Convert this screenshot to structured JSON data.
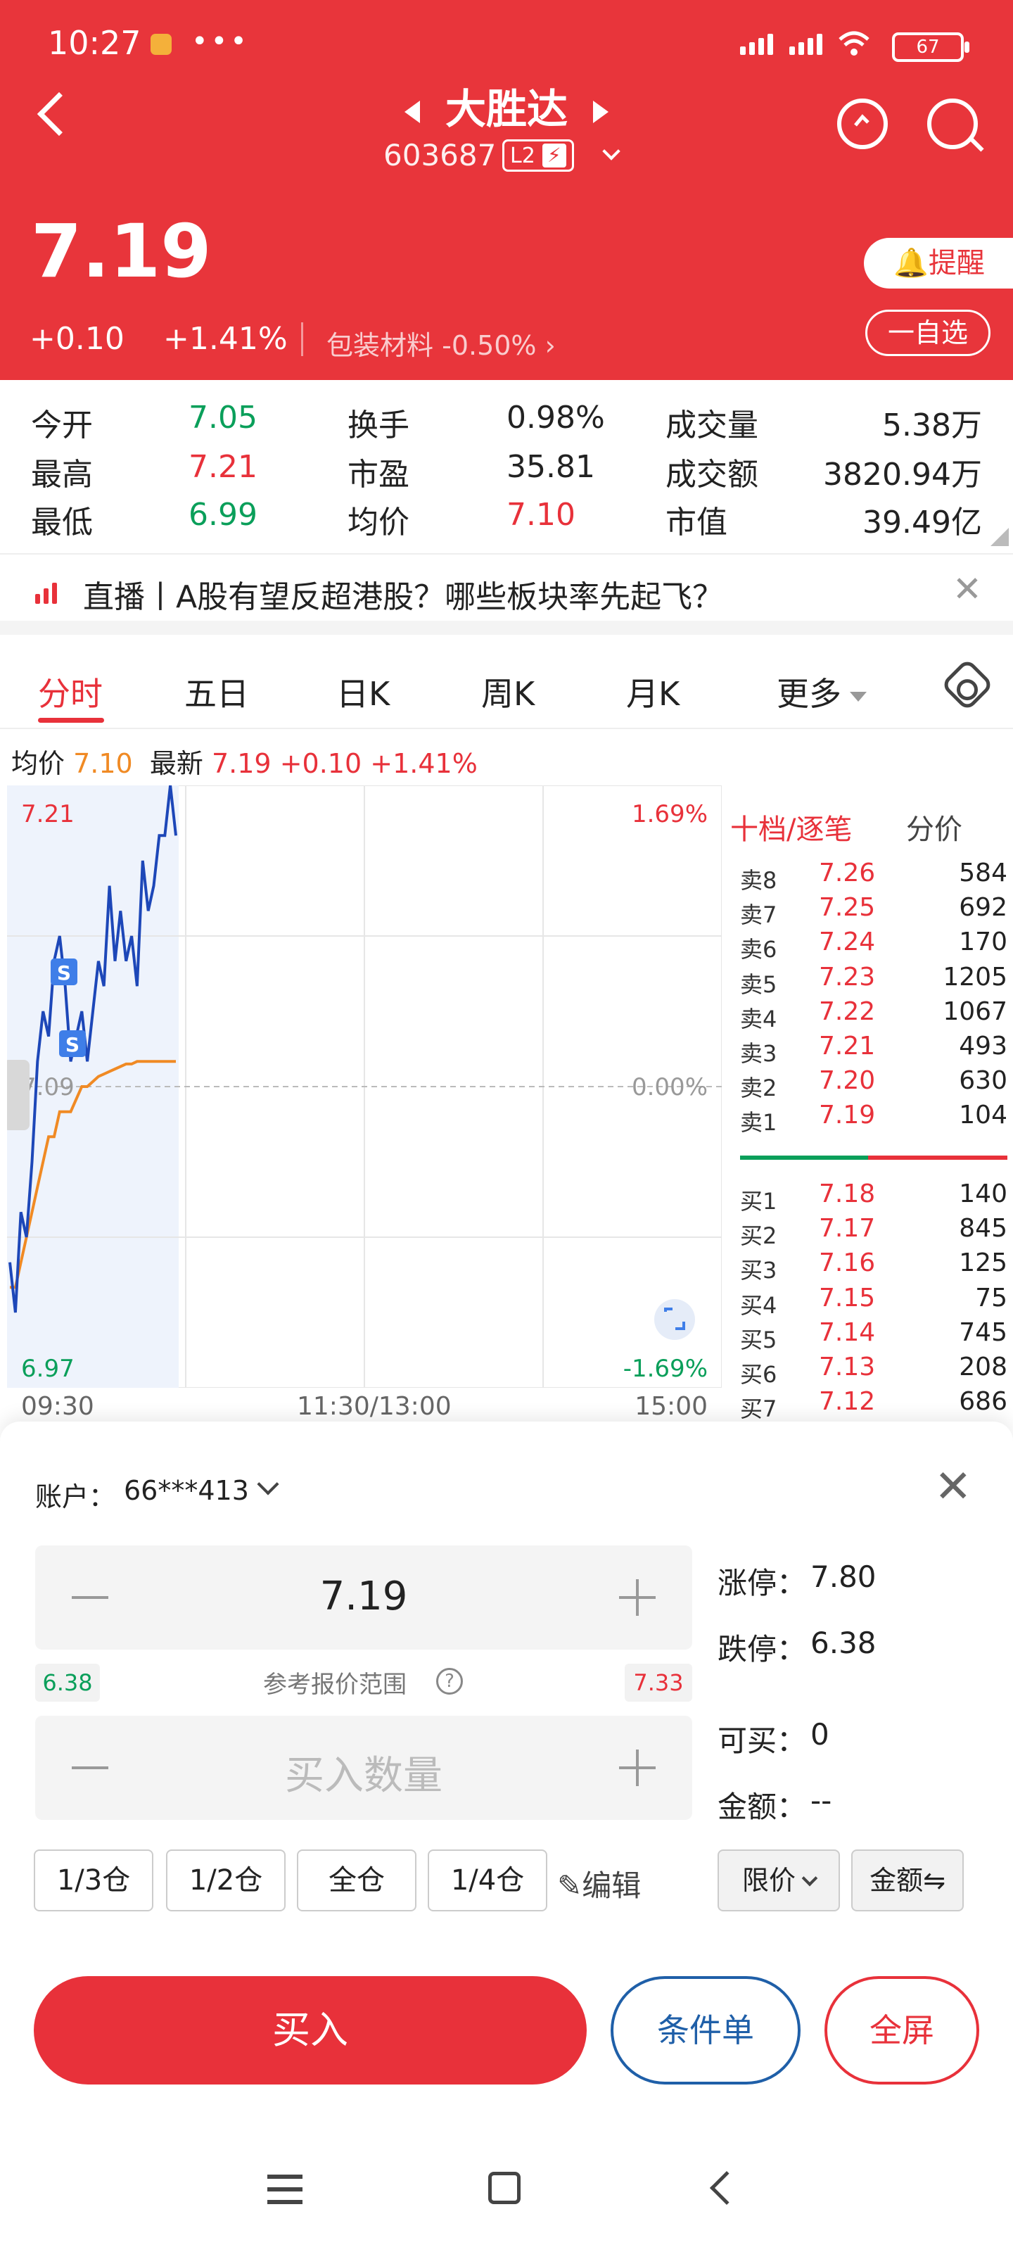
{
  "status": {
    "time": "10:27",
    "dots": "•••",
    "battery": "67"
  },
  "header": {
    "name": "大胜达",
    "code": "603687",
    "l2_label": "L2",
    "l2_icon": "lightning-icon",
    "price": "7.19",
    "change": "+0.10",
    "change_pct": "+1.41%",
    "sector": "包装材料",
    "sector_pct": "-0.50%",
    "sector_arrow": "›",
    "remind_label": "提醒",
    "add_fav_label": "一自选"
  },
  "quote": {
    "open_label": "今开",
    "open": "7.05",
    "high_label": "最高",
    "high": "7.21",
    "low_label": "最低",
    "low": "6.99",
    "turnover_label": "换手",
    "turnover": "0.98%",
    "pe_label": "市盈",
    "pe": "35.81",
    "avg_label": "均价",
    "avg": "7.10",
    "volume_label": "成交量",
    "volume": "5.38万",
    "amount_label": "成交额",
    "amount": "3820.94万",
    "mcap_label": "市值",
    "mcap": "39.49亿"
  },
  "ticker": {
    "text": "直播丨A股有望反超港股？哪些板块率先起飞？",
    "close": "✕"
  },
  "tabs": [
    {
      "label": "分时",
      "active": true
    },
    {
      "label": "五日"
    },
    {
      "label": "日K"
    },
    {
      "label": "周K"
    },
    {
      "label": "月K"
    },
    {
      "label": "更多"
    }
  ],
  "legend": {
    "avg_label": "均价",
    "avg": "7.10",
    "last_label": "最新",
    "last": "7.19",
    "chg": "+0.10",
    "pct": "+1.41%"
  },
  "chart_data": {
    "type": "line",
    "y_labels": {
      "top": "7.21",
      "bottom": "6.97",
      "top_pct": "1.69%",
      "mid_pct": "0.00%",
      "bottom_pct": "-1.69%",
      "mid_price": "7.09"
    },
    "ylim": [
      6.97,
      7.21
    ],
    "x_ticks": [
      "09:30",
      "11:30/13:00",
      "15:00"
    ],
    "markers": [
      "S",
      "S"
    ],
    "series": [
      {
        "values": [
          7.02,
          7.0,
          7.04,
          7.03,
          7.06,
          7.1,
          7.12,
          7.11,
          7.14,
          7.15,
          7.13,
          7.1,
          7.11,
          7.12,
          7.1,
          7.12,
          7.14,
          7.13,
          7.17,
          7.14,
          7.16,
          7.14,
          7.15,
          7.13,
          7.18,
          7.16,
          7.17,
          7.19,
          7.19,
          7.21,
          7.19
        ]
      },
      {
        "values": [
          7.01,
          7.01,
          7.02,
          7.03,
          7.04,
          7.05,
          7.06,
          7.07,
          7.07,
          7.08,
          7.08,
          7.08,
          7.085,
          7.09,
          7.09,
          7.092,
          7.094,
          7.095,
          7.096,
          7.097,
          7.098,
          7.099,
          7.099,
          7.1,
          7.1,
          7.1,
          7.1,
          7.1,
          7.1,
          7.1,
          7.1
        ]
      }
    ]
  },
  "orderbook": {
    "tab_active": "十档/逐笔",
    "tab_other": "分价",
    "asks": [
      {
        "k": "卖8",
        "p": "7.26",
        "v": "584"
      },
      {
        "k": "卖7",
        "p": "7.25",
        "v": "692"
      },
      {
        "k": "卖6",
        "p": "7.24",
        "v": "170"
      },
      {
        "k": "卖5",
        "p": "7.23",
        "v": "1205"
      },
      {
        "k": "卖4",
        "p": "7.22",
        "v": "1067"
      },
      {
        "k": "卖3",
        "p": "7.21",
        "v": "493"
      },
      {
        "k": "卖2",
        "p": "7.20",
        "v": "630"
      },
      {
        "k": "卖1",
        "p": "7.19",
        "v": "104"
      }
    ],
    "bids": [
      {
        "k": "买1",
        "p": "7.18",
        "v": "140"
      },
      {
        "k": "买2",
        "p": "7.17",
        "v": "845"
      },
      {
        "k": "买3",
        "p": "7.16",
        "v": "125"
      },
      {
        "k": "买4",
        "p": "7.15",
        "v": "75"
      },
      {
        "k": "买5",
        "p": "7.14",
        "v": "745"
      },
      {
        "k": "买6",
        "p": "7.13",
        "v": "208"
      },
      {
        "k": "买7",
        "p": "7.12",
        "v": "686"
      }
    ]
  },
  "trade": {
    "account_label": "账户：",
    "account": "66***413",
    "price_value": "7.19",
    "limit_up_label": "涨停：",
    "limit_up": "7.80",
    "limit_down_label": "跌停：",
    "limit_down": "6.38",
    "range_low": "6.38",
    "range_label": "参考报价范围",
    "range_high": "7.33",
    "qty_placeholder": "买入数量",
    "can_buy_label": "可买：",
    "can_buy": "0",
    "amount_label": "金额：",
    "amount": "--",
    "positions": [
      "1/3仓",
      "1/2仓",
      "全仓",
      "1/4仓"
    ],
    "edit_label": "编辑",
    "order_type": "限价",
    "amount_toggle": "金额⇋",
    "buy_label": "买入",
    "cond_label": "条件单",
    "full_label": "全屏"
  }
}
